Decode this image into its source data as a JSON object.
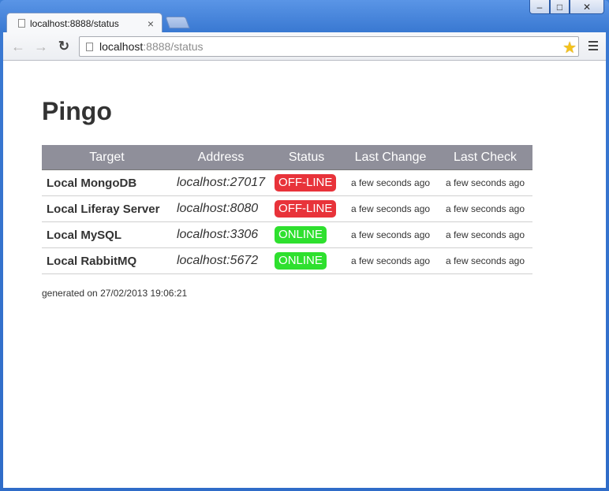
{
  "browser": {
    "tab_title": "localhost:8888/status",
    "url_host": "localhost",
    "url_rest": ":8888/status",
    "window_controls": {
      "minimize": "‒",
      "maximize": "□",
      "close": "✕"
    }
  },
  "page": {
    "title": "Pingo",
    "columns": [
      "Target",
      "Address",
      "Status",
      "Last Change",
      "Last Check"
    ],
    "rows": [
      {
        "target": "Local MongoDB",
        "address": "localhost:27017",
        "status": "OFF-LINE",
        "last_change": "a few seconds ago",
        "last_check": "a few seconds ago"
      },
      {
        "target": "Local Liferay Server",
        "address": "localhost:8080",
        "status": "OFF-LINE",
        "last_change": "a few seconds ago",
        "last_check": "a few seconds ago"
      },
      {
        "target": "Local MySQL",
        "address": "localhost:3306",
        "status": "ONLINE",
        "last_change": "a few seconds ago",
        "last_check": "a few seconds ago"
      },
      {
        "target": "Local RabbitMQ",
        "address": "localhost:5672",
        "status": "ONLINE",
        "last_change": "a few seconds ago",
        "last_check": "a few seconds ago"
      }
    ],
    "generated": "generated on 27/02/2013 19:06:21"
  },
  "colors": {
    "offline": "#e8333a",
    "online": "#2ee02e",
    "header_bg": "#8f8f9a"
  },
  "icons": {
    "back": "arrow-left-icon",
    "forward": "arrow-right-icon",
    "reload": "reload-icon",
    "bookmark": "star-icon",
    "menu": "menu-icon",
    "page": "page-icon"
  }
}
